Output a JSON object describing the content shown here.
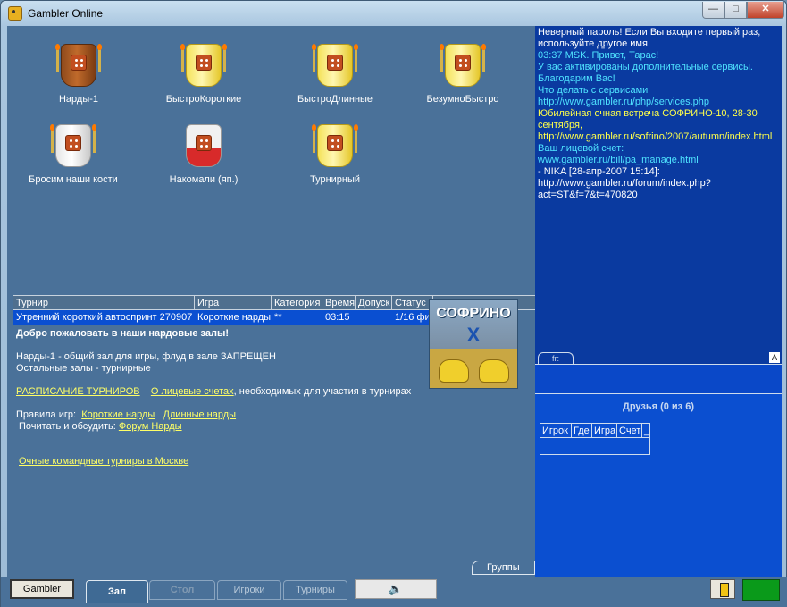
{
  "window": {
    "title": "Gambler Online",
    "minimize": "—",
    "maximize": "□",
    "close": "✕"
  },
  "rooms": [
    {
      "label": "Нарды-1",
      "icon": "brown-dice-cup-icon"
    },
    {
      "label": "БыстроКороткие",
      "icon": "yellow-dice-cup-icon"
    },
    {
      "label": "БыстроДлинные",
      "icon": "yellow-dice-cup-icon"
    },
    {
      "label": "БезумноБыстро",
      "icon": "yellow-dice-cup-icon"
    },
    {
      "label": "Бросим наши кости",
      "icon": "white-dice-cup-icon"
    },
    {
      "label": "Накомали (яп.)",
      "icon": "red-dice-cup-icon"
    },
    {
      "label": "Турнирный",
      "icon": "yellow-dice-cup-icon"
    }
  ],
  "tournaments": {
    "headers": [
      "Турнир",
      "Игра",
      "Категория",
      "Время",
      "Допуск",
      "Статус"
    ],
    "rows": [
      {
        "name": "Утренний короткий автоспринт 270907",
        "game": "Короткие нарды II",
        "category": "**",
        "time": "03:15",
        "access": "1/16 фи"
      }
    ]
  },
  "info": {
    "welcome": "Добро пожаловать в наши нардовые залы!",
    "line1": "Нарды-1 - общий зал для игры, флуд в зале ЗАПРЕЩЕН",
    "line2": "Остальные залы - турнирные",
    "schedule_link": "РАСПИСАНИЕ ТУРНИРОВ",
    "accounts_link": "О лицевые счетах",
    "accounts_suffix": ", необходимых для участия в турнирах",
    "rules_label": "Правила игр:",
    "rules_short": "Короткие нарды",
    "rules_long": "Длинные нарды",
    "forum_label": "Почитать и обсудить:",
    "forum_link": "Форум Нарды",
    "moscow_link": "Очные командные турниры в Москве"
  },
  "ad": {
    "title": "СОФРИНО",
    "sub": "X"
  },
  "groups_tab": "Группы",
  "chat": {
    "messages": [
      {
        "text": "Неверный пароль! Если Вы входите первый раз, используйте другое имя",
        "color": "white"
      },
      {
        "text": "03:37 MSK. Привет, Тарас!",
        "color": "cyan"
      },
      {
        "text": "У вас активированы дополнительные сервисы. Благодарим Вас!",
        "color": "cyan"
      },
      {
        "text": "Что делать с сервисами",
        "color": "cyan"
      },
      {
        "text": "http://www.gambler.ru/php/services.php",
        "color": "cyan"
      },
      {
        "text": "Юбилейная очная встреча СОФРИНО-10, 28-30 сентября,",
        "color": "yellow"
      },
      {
        "text": "http://www.gambler.ru/sofrino/2007/autumn/index.html",
        "color": "yellow"
      },
      {
        "text": "Ваш лицевой счет:",
        "color": "cyan"
      },
      {
        "text": "www.gambler.ru/bill/pa_manage.html",
        "color": "cyan"
      },
      {
        "text": " - NIKA [28-апр-2007 15:14]:",
        "color": "white"
      },
      {
        "text": "http://www.gambler.ru/forum/index.php?act=ST&f=7&t=470820",
        "color": "white"
      }
    ],
    "fr_tab": "fr:",
    "a_button": "A"
  },
  "friends": {
    "title": "Друзья (0 из 6)",
    "headers": [
      "Игрок",
      "Где",
      "Игра",
      "Счет",
      "_"
    ]
  },
  "bottom": {
    "gambler_button": "Gambler",
    "tab_hall": "Зал",
    "tab_table": "Стол",
    "tab_players": "Игроки",
    "tab_tournaments": "Турниры",
    "sound_icon": "speaker-icon"
  },
  "colors": {
    "background": "#4a7199",
    "chat_bg": "#0a3aa0",
    "friends_bg": "#0b4fd0",
    "selected_row": "#0a4fd1",
    "link": "#ffff66",
    "status": "#0a9a1a"
  }
}
